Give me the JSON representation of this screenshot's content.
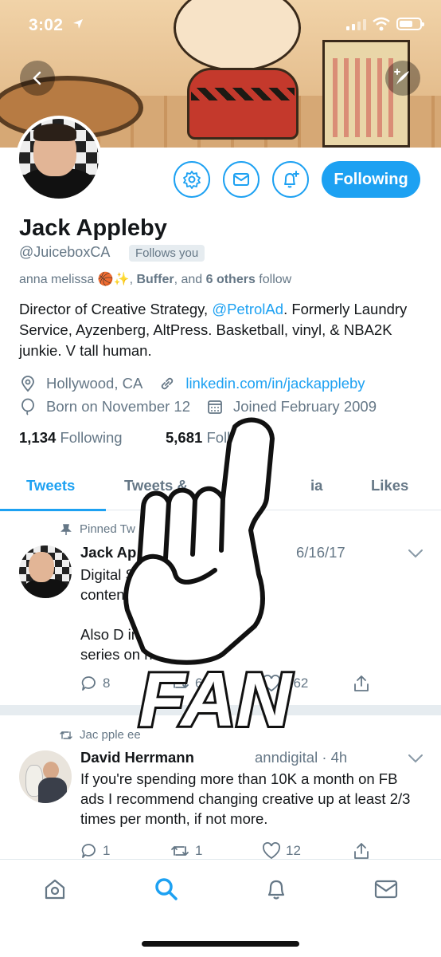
{
  "status_bar": {
    "time": "3:02"
  },
  "profile": {
    "name": "Jack Appleby",
    "handle": "@JuiceboxCA",
    "follows_you": "Follows you",
    "followed_by": {
      "part1": "anna melissa 🏀✨, ",
      "buffer": "Buffer",
      "part2": ", and ",
      "others": "6 others",
      "part3": " follow"
    },
    "bio": {
      "line_a": "Director of Creative Strategy, ",
      "mention": "@PetrolAd",
      "line_b": ". Formerly Laundry Service, Ayzenberg, AltPress. Basketball, vinyl, & NBA2K junkie. V tall human."
    },
    "location": "Hollywood, CA",
    "website": "linkedin.com/in/jackappleby",
    "birthday": "Born on November 12",
    "joined": "Joined February 2009",
    "following_count": "1,134",
    "following_label": "Following",
    "followers_count": "5,681",
    "followers_label": "Followe"
  },
  "actions": {
    "following_button": "Following"
  },
  "tabs": [
    {
      "label": "Tweets",
      "active": true
    },
    {
      "label": "Tweets &"
    },
    {
      "label": "ia"
    },
    {
      "label": "Likes"
    }
  ],
  "tweets": [
    {
      "context": "Pinned Tw",
      "name": "Jack Ap",
      "meta": "6/16/17",
      "body": "Digital S               atches long-form\ncontent!\n\nAlso D                  inged an entire\nseries on                     nd\"",
      "replies": "8",
      "retweets": "63",
      "likes": "262"
    },
    {
      "context": "Jac   pple    ee",
      "name": "David Herrmann",
      "meta": "anndigital · 4h",
      "body": "If you're spending more than 10K a month on FB ads I recommend changing creative up at least 2/3 times per month, if not more.",
      "replies": "1",
      "retweets": "1",
      "likes": "12"
    }
  ],
  "overlay": {
    "text": "FAN"
  },
  "icons": [
    "location-arrow-icon",
    "back-icon",
    "compose-icon",
    "gear-icon",
    "mail-icon",
    "bell-plus-icon",
    "location-pin-icon",
    "link-icon",
    "balloon-icon",
    "calendar-icon",
    "pin-icon",
    "retweet-icon",
    "chevron-down-icon",
    "reply-icon",
    "heart-icon",
    "share-icon",
    "home-icon",
    "search-icon",
    "bell-icon",
    "messages-icon"
  ],
  "colors": {
    "accent": "#1da1f2",
    "secondary_text": "#657786",
    "primary_text": "#14171a"
  }
}
